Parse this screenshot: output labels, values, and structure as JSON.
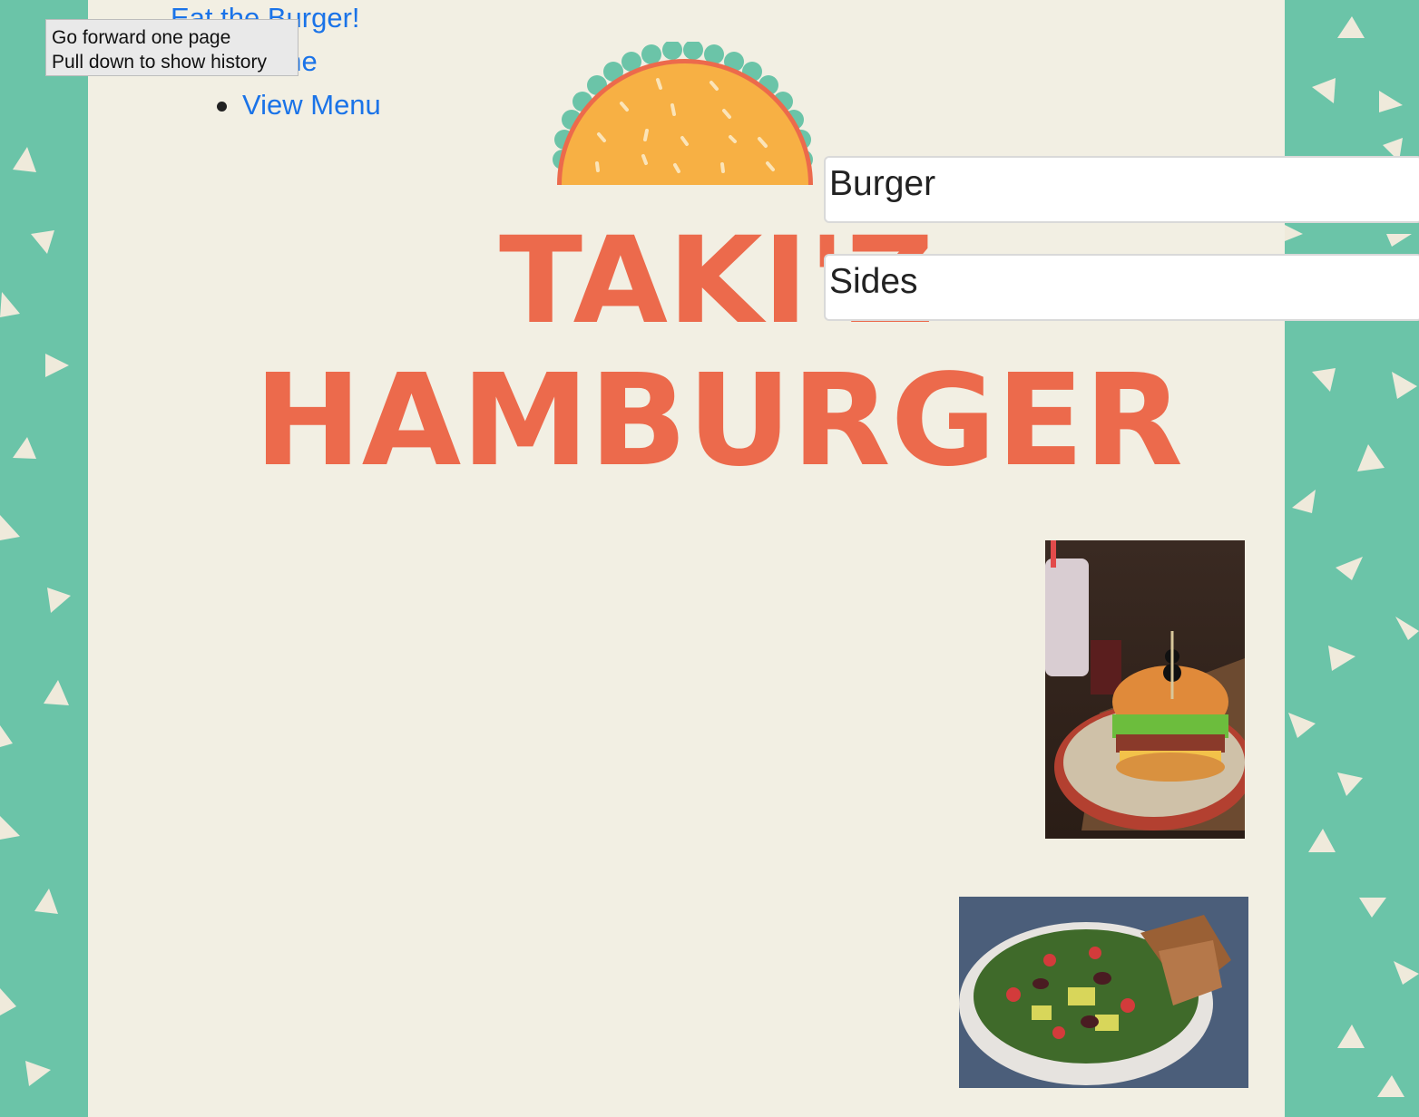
{
  "page": {
    "background": "#f2efe3",
    "accent_green": "#6bc4a8",
    "link_color": "#1a73e8",
    "logo_color": "#ec6a4c"
  },
  "nav": {
    "items": [
      {
        "label": "Eat the Burger!"
      },
      {
        "label": "Home"
      },
      {
        "label": "View Menu"
      }
    ]
  },
  "tooltip": {
    "line1": "Go forward one page",
    "line2": "Pull down to show history"
  },
  "logo": {
    "line1": "TAKI'Z",
    "line2": "HAMBURGER",
    "icon": "taco-bun-icon"
  },
  "menu": {
    "sections": [
      {
        "label": "Burger"
      },
      {
        "label": "Sides"
      }
    ]
  },
  "images": {
    "burger": "burger-photo",
    "salad": "salad-photo"
  }
}
